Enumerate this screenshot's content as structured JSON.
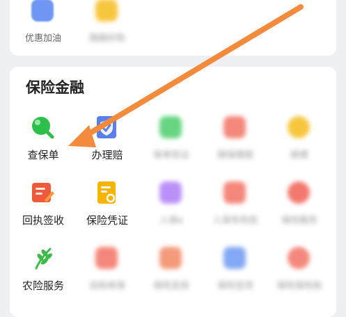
{
  "top_row": [
    {
      "label": "优惠加油",
      "color": "#4a7df0"
    },
    {
      "label": "随路好助",
      "color": "#f5b400"
    }
  ],
  "section": {
    "title": "保险金融"
  },
  "rows": [
    [
      {
        "label": "查保单",
        "icon": "search-policy-icon",
        "color": "#2cbf4a"
      },
      {
        "label": "办理赔",
        "icon": "claim-shield-icon",
        "color": "#5b7fe8"
      },
      {
        "label": "保单验证",
        "icon": "green-app-icon",
        "color": "#34c759",
        "blurred": true
      },
      {
        "label": "随保随赔",
        "icon": "red-app-icon",
        "color": "#f1604f",
        "blurred": true
      },
      {
        "label": "随便",
        "icon": "yellow-app-icon",
        "color": "#f5b400",
        "blurred": true
      }
    ],
    [
      {
        "label": "回执签收",
        "icon": "receipt-sign-icon",
        "color": "#f05a3c"
      },
      {
        "label": "保险凭证",
        "icon": "insurance-certificate-icon",
        "color": "#f5b400"
      },
      {
        "label": "人保e",
        "icon": "purple-app-icon",
        "color": "#a46cf5",
        "blurred": true
      },
      {
        "label": "人保车险验",
        "icon": "red-app-icon",
        "color": "#f1604f",
        "blurred": true
      },
      {
        "label": "保险服务",
        "icon": "red-app-icon",
        "color": "#ef4b3d",
        "blurred": true
      }
    ],
    [
      {
        "label": "农险服务",
        "icon": "wheat-icon",
        "color": "#3dbb4a"
      },
      {
        "label": "自助续保",
        "icon": "renewal-icon",
        "color": "#f1604f",
        "blurred": true
      },
      {
        "label": "保险定损",
        "icon": "orange-app-icon",
        "color": "#f07a4f",
        "blurred": true
      },
      {
        "label": "保险信贷",
        "icon": "blue-app-icon",
        "color": "#5b8cf0",
        "blurred": true
      },
      {
        "label": "保险保险助",
        "icon": "red-app-icon",
        "color": "#f1604f",
        "blurred": true
      }
    ]
  ],
  "annotation": {
    "arrow_color": "#f48a3c"
  }
}
